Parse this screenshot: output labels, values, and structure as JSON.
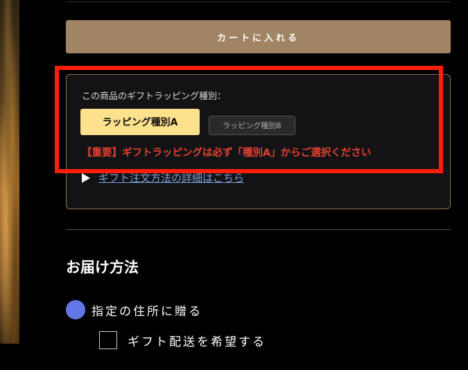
{
  "cart": {
    "button_label": "カートに入れる"
  },
  "gift": {
    "label": "この商品のギフトラッピング種別：",
    "option_a": "ラッピング種別A",
    "option_b": "ラッピング種別B",
    "selected": "ラッピング種別A",
    "notice": "【重要】ギフトラッピングは必ず「種別A」からご選択ください",
    "detail_link": "ギフト注文方法の詳細はこちら"
  },
  "delivery": {
    "title": "お届け方法",
    "radio_label": "指定の住所に贈る",
    "radio_selected": true,
    "checkbox_label": "ギフト配送を希望する",
    "checkbox_checked": false
  },
  "colors": {
    "accent_button": "#a08463",
    "selected_option": "#fde18c",
    "notice_red": "#e84030",
    "highlight_red": "#ff1e0a",
    "radio_blue": "#6277e6",
    "link_blue": "#7da0d8"
  },
  "icons": {
    "disclosure": "triangle-right-icon"
  }
}
